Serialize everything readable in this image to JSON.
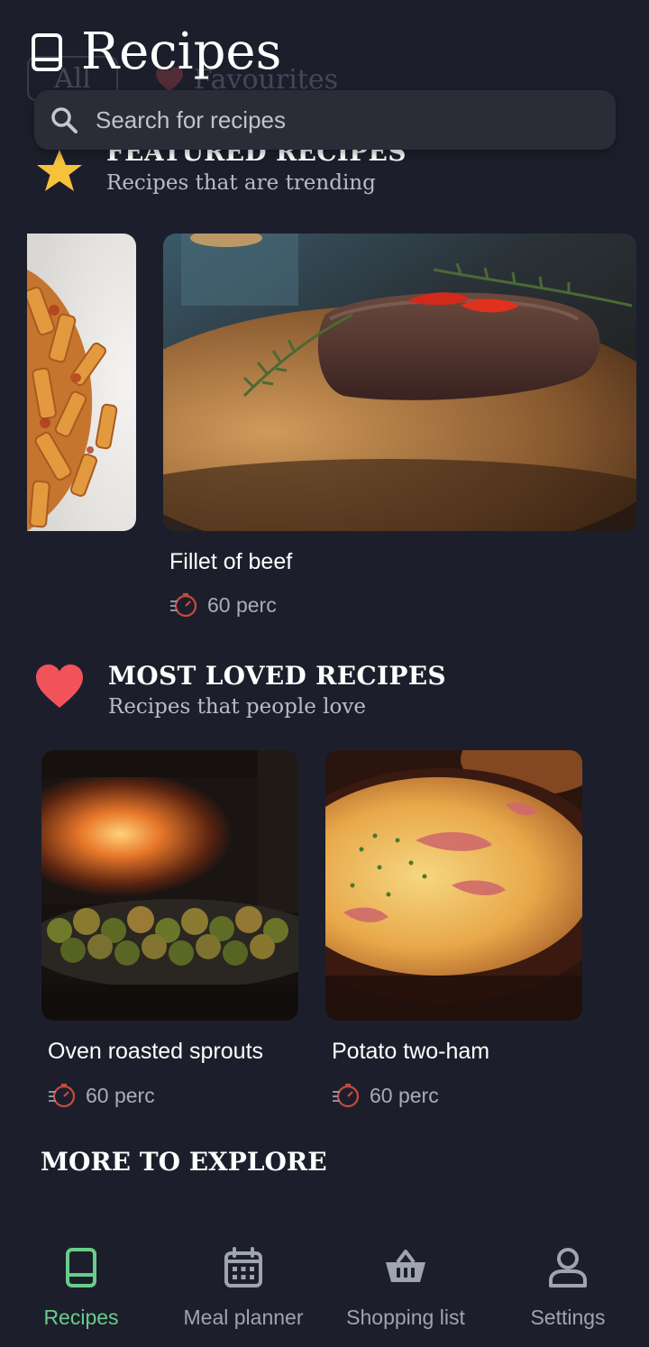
{
  "header": {
    "title": "Recipes",
    "icon": "book-icon"
  },
  "filter_chips": [
    {
      "label": "All"
    },
    {
      "label": "Favourites"
    }
  ],
  "search": {
    "placeholder": "Search for recipes",
    "value": ""
  },
  "featured": {
    "title": "FEATURED RECIPES",
    "subtitle": "Recipes that are trending",
    "icon": "star-icon",
    "icon_color": "#f6c13b",
    "cards": [
      {
        "title": "",
        "time": "",
        "image": "penne-pasta-image"
      },
      {
        "title": "Fillet of beef",
        "time": "60 perc",
        "image": "beef-fillet-image"
      }
    ]
  },
  "most_loved": {
    "title": "MOST LOVED RECIPES",
    "subtitle": "Recipes that people love",
    "icon": "heart-icon",
    "icon_color": "#f0545a",
    "cards": [
      {
        "title": "Oven roasted sprouts",
        "time": "60 perc",
        "image": "roasted-sprouts-image"
      },
      {
        "title": "Potato two-ham",
        "time": "60 perc",
        "image": "potato-ham-gratin-image"
      }
    ]
  },
  "explore": {
    "title": "MORE TO EXPLORE"
  },
  "nav": {
    "active_color": "#69cd8a",
    "items": [
      {
        "label": "Recipes",
        "icon": "book-icon",
        "active": true
      },
      {
        "label": "Meal planner",
        "icon": "calendar-icon",
        "active": false
      },
      {
        "label": "Shopping list",
        "icon": "basket-icon",
        "active": false
      },
      {
        "label": "Settings",
        "icon": "user-icon",
        "active": false
      }
    ]
  }
}
